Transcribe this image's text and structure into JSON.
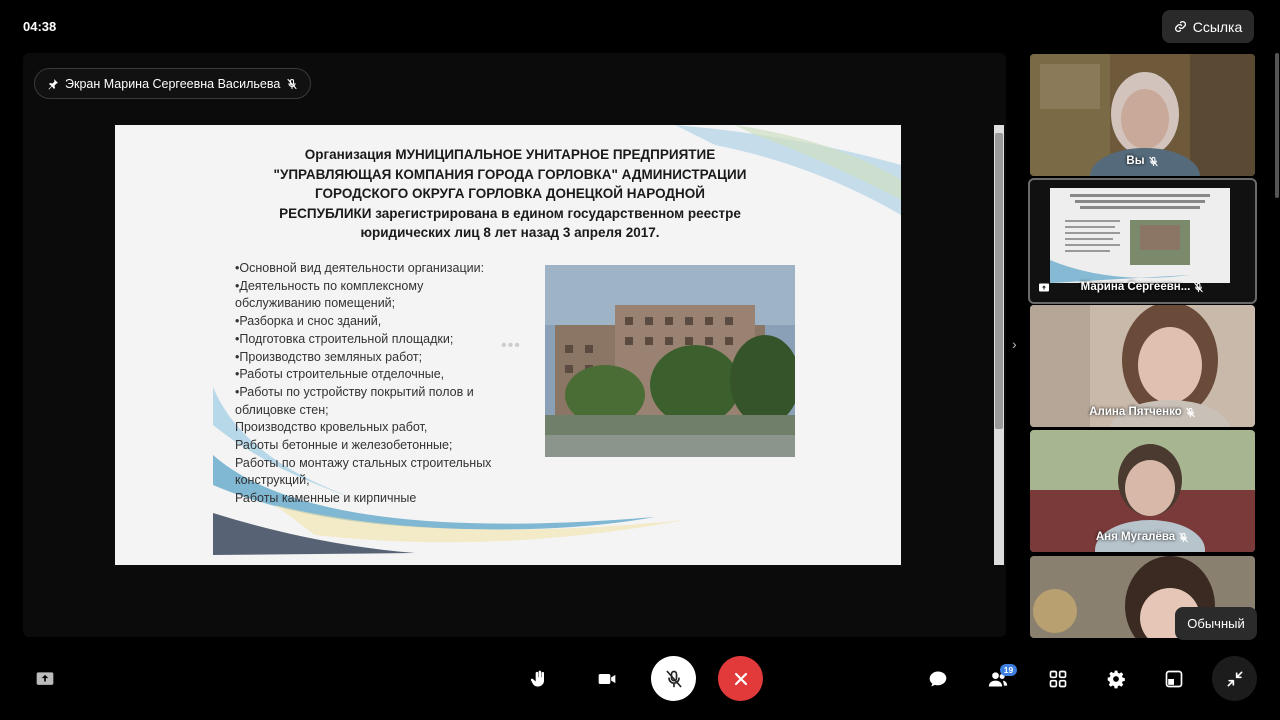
{
  "header": {
    "time": "04:38",
    "link_label": "Ссылка"
  },
  "screen_share": {
    "label": "Экран Марина Сергеевна Васильева"
  },
  "slide": {
    "title_lines": [
      "Организация МУНИЦИПАЛЬНОЕ УНИТАРНОЕ ПРЕДПРИЯТИЕ",
      "\"УПРАВЛЯЮЩАЯ КОМПАНИЯ ГОРОДА ГОРЛОВКА\" АДМИНИСТРАЦИИ",
      "ГОРОДСКОГО ОКРУГА ГОРЛОВКА ДОНЕЦКОЙ НАРОДНОЙ",
      "РЕСПУБЛИКИ зарегистрирована в едином государственном реестре",
      "юридических лиц 8 лет назад 3 апреля 2017."
    ],
    "list_lines": [
      "•Основной вид деятельности организации:",
      "•Деятельность по комплексному",
      "обслуживанию помещений;",
      "•Разборка и снос зданий,",
      "•Подготовка строительной площадки;",
      "•Производство земляных работ;",
      "•Работы строительные отделочные,",
      "•Работы по устройству покрытий полов и",
      "облицовке стен;",
      "Производство кровельных работ,",
      "Работы бетонные и железобетонные;",
      "Работы по монтажу стальных строительных",
      "конструкций,",
      "Работы каменные и кирпичные"
    ]
  },
  "participants": [
    {
      "name": "Вы",
      "muted": true
    },
    {
      "name": "Марина Сергеевн...",
      "muted": true,
      "sharing": true,
      "active": true
    },
    {
      "name": "Алина Пятченко",
      "muted": true
    },
    {
      "name": "Аня Мугалёва",
      "muted": true
    },
    {
      "name": "",
      "muted": false
    }
  ],
  "tooltip": "Обычный",
  "toolbar": {
    "participants_count": "19"
  },
  "colors": {
    "end_call": "#e2393a",
    "badge": "#3d7fe0"
  }
}
